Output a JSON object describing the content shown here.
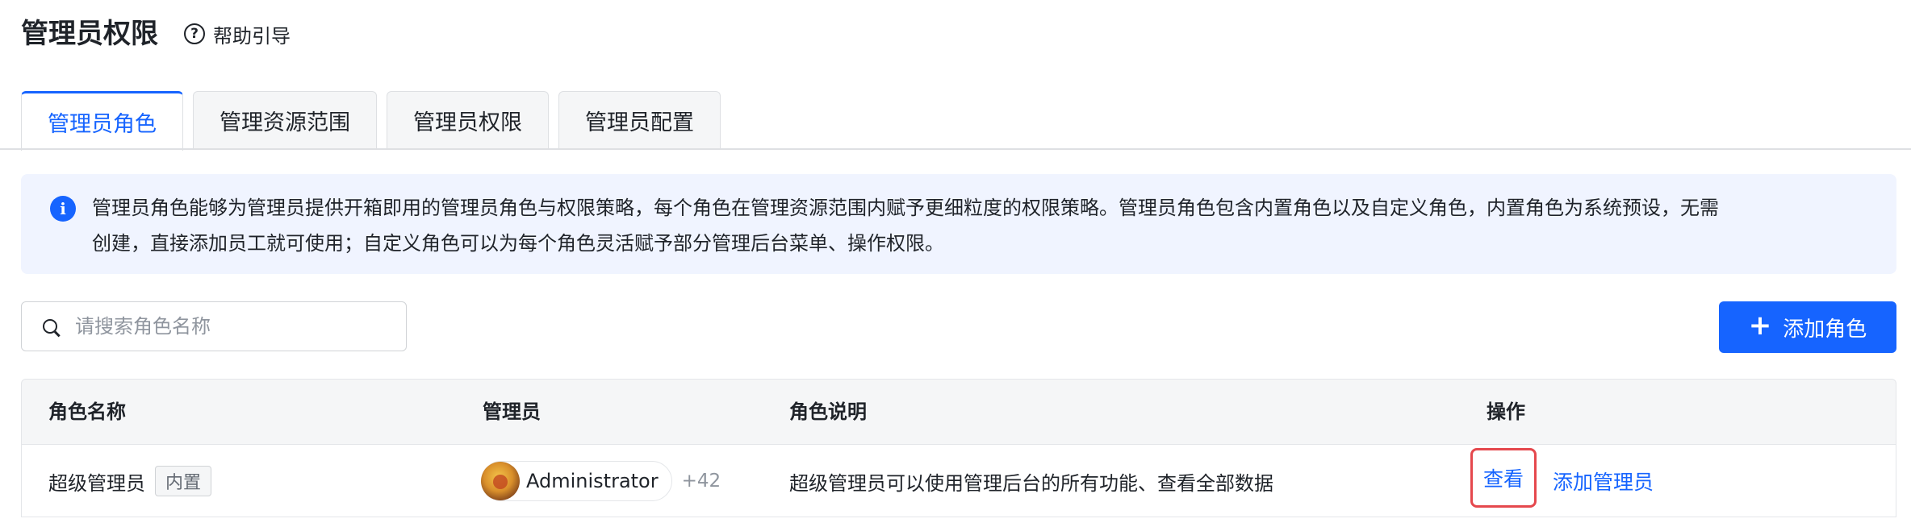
{
  "header": {
    "title": "管理员权限",
    "help_label": "帮助引导"
  },
  "tabs": [
    {
      "label": "管理员角色",
      "active": true
    },
    {
      "label": "管理资源范围",
      "active": false
    },
    {
      "label": "管理员权限",
      "active": false
    },
    {
      "label": "管理员配置",
      "active": false
    }
  ],
  "banner": {
    "icon": "info-icon",
    "line1": "管理员角色能够为管理员提供开箱即用的管理员角色与权限策略，每个角色在管理资源范围内赋予更细粒度的权限策略。管理员角色包含内置角色以及自定义角色，内置角色为系统预设，无需",
    "line2": "创建，直接添加员工就可使用；自定义角色可以为每个角色灵活赋予部分管理后台菜单、操作权限。"
  },
  "search": {
    "placeholder": "请搜索角色名称",
    "value": ""
  },
  "toolbar": {
    "add_role_label": "添加角色"
  },
  "table": {
    "columns": [
      "角色名称",
      "管理员",
      "角色说明",
      "操作"
    ],
    "rows": [
      {
        "role_name": "超级管理员",
        "tag": "内置",
        "admin_name": "Administrator",
        "admin_more": "+42",
        "description": "超级管理员可以使用管理后台的所有功能、查看全部数据",
        "actions": [
          "查看",
          "添加管理员"
        ]
      }
    ]
  },
  "colors": {
    "accent": "#1664ff",
    "highlight": "#e5484d",
    "banner_bg": "#f0f4ff"
  }
}
